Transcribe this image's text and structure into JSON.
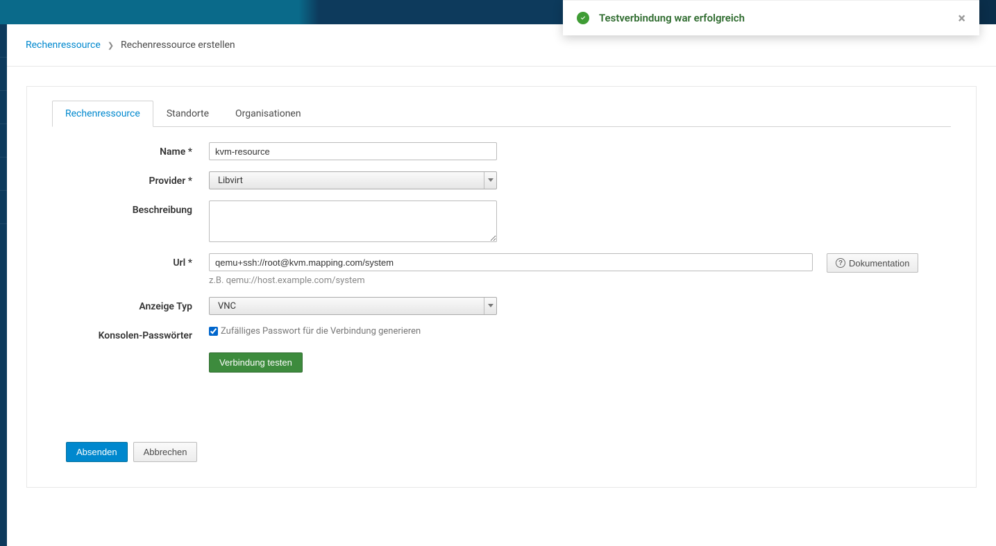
{
  "toast": {
    "message": "Testverbindung war erfolgreich"
  },
  "breadcrumb": {
    "parent": "Rechenressource",
    "current": "Rechenressource erstellen"
  },
  "tabs": {
    "t0": "Rechenressource",
    "t1": "Standorte",
    "t2": "Organisationen"
  },
  "form": {
    "name_label": "Name *",
    "name_value": "kvm-resource",
    "provider_label": "Provider *",
    "provider_value": "Libvirt",
    "description_label": "Beschreibung",
    "description_value": "",
    "url_label": "Url *",
    "url_value": "qemu+ssh://root@kvm.mapping.com/system",
    "url_help": "z.B. qemu://host.example.com/system",
    "documentation_label": "Dokumentation",
    "display_type_label": "Anzeige Typ",
    "display_type_value": "VNC",
    "console_pw_label": "Konsolen-Passwörter",
    "console_pw_checkbox_label": "Zufälliges Passwort für die Verbindung generieren",
    "test_button": "Verbindung testen"
  },
  "actions": {
    "submit": "Absenden",
    "cancel": "Abbrechen"
  }
}
